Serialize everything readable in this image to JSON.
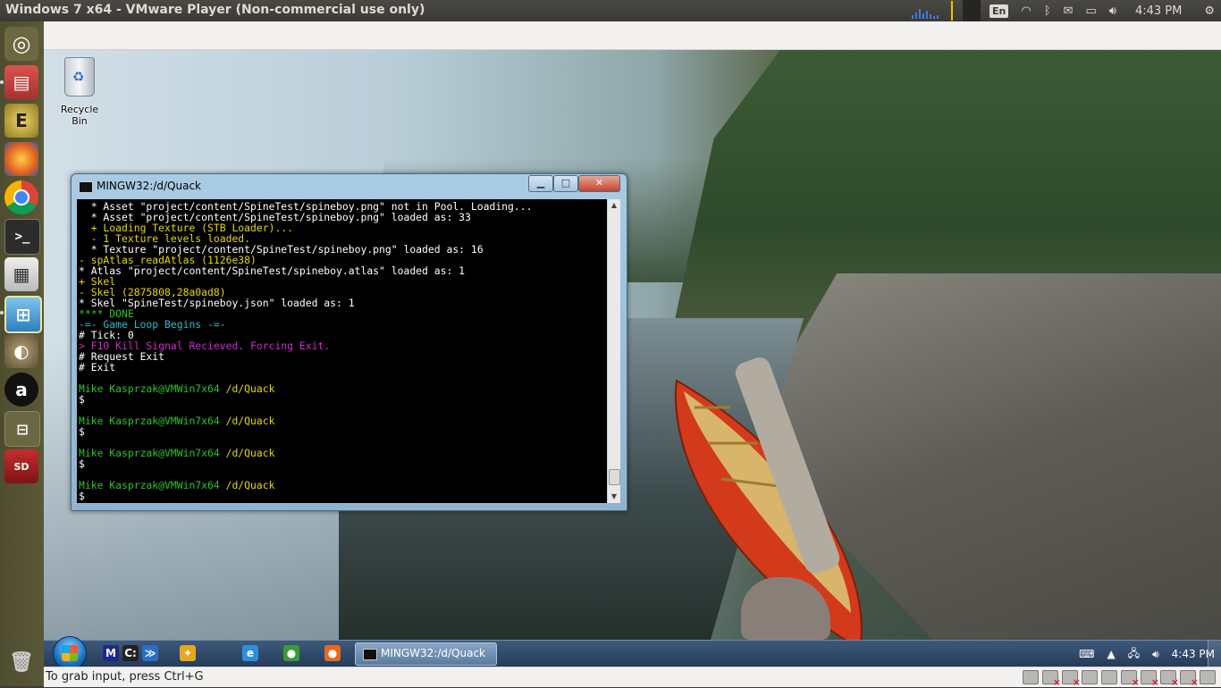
{
  "top_panel": {
    "window_title": "Windows 7 x64 - VMware Player (Non-commercial use only)",
    "keyboard_layout": "En",
    "clock": "4:43 PM"
  },
  "launcher": {
    "items": [
      {
        "name": "Dash home",
        "icon": "ubuntu-logo-icon"
      },
      {
        "name": "Files",
        "icon": "file-cabinet-icon"
      },
      {
        "name": "Mail",
        "icon": "mail-e-icon"
      },
      {
        "name": "Firefox",
        "icon": "firefox-icon"
      },
      {
        "name": "Chrome",
        "icon": "chrome-icon"
      },
      {
        "name": "Terminal",
        "icon": "terminal-icon"
      },
      {
        "name": "Calculator",
        "icon": "calculator-icon"
      },
      {
        "name": "VMware Player",
        "icon": "vmware-icon"
      },
      {
        "name": "GIMP",
        "icon": "gimp-icon"
      },
      {
        "name": "Audacity",
        "icon": "audacity-icon"
      },
      {
        "name": "Workspaces",
        "icon": "workspace-icon"
      },
      {
        "name": "SD Card",
        "icon": "sd-card-icon"
      },
      {
        "name": "Trash",
        "icon": "trash-icon"
      }
    ]
  },
  "desktop": {
    "recycle_bin_label": "Recycle Bin"
  },
  "terminal": {
    "title": "MINGW32:/d/Quack",
    "lines": [
      {
        "text": "  * Asset \"project/content/SpineTest/spineboy.png\" not in Pool. Loading...",
        "color": "#ffffff"
      },
      {
        "text": "  * Asset \"project/content/SpineTest/spineboy.png\" loaded as: 33",
        "color": "#ffffff"
      },
      {
        "text": "  + Loading Texture (STB Loader)...",
        "color": "#e6d800"
      },
      {
        "text": "  - 1 Texture levels loaded.",
        "color": "#e6d800"
      },
      {
        "text": "  * Texture \"project/content/SpineTest/spineboy.png\" loaded as: 16",
        "color": "#ffffff"
      },
      {
        "text": "- spAtlas_readAtlas (1126e38)",
        "color": "#e6d800"
      },
      {
        "text": "* Atlas \"project/content/SpineTest/spineboy.atlas\" loaded as: 1",
        "color": "#ffffff"
      },
      {
        "text": "+ Skel",
        "color": "#e6d800"
      },
      {
        "text": "- Skel (2875808,28a0ad8)",
        "color": "#e6d800"
      },
      {
        "text": "* Skel \"SpineTest/spineboy.json\" loaded as: 1",
        "color": "#ffffff"
      },
      {
        "text": "**** DONE",
        "color": "#2ec22e"
      },
      {
        "text": "-=- Game Loop Begins -=-",
        "color": "#2bbccb"
      },
      {
        "text": "# Tick: 0",
        "color": "#ffffff"
      },
      {
        "text": "> F10 Kill Signal Recieved. Forcing Exit.",
        "color": "#d22ad2"
      },
      {
        "text": "# Request Exit",
        "color": "#ffffff"
      },
      {
        "text": "# Exit",
        "color": "#ffffff"
      },
      {
        "text": "",
        "color": "#ffffff"
      },
      {
        "text": "Mike Kasprzak@VMWin7x64 /d/Quack",
        "color": "#2ec22e",
        "path": "/d/Quack",
        "path_color": "#e6d800"
      },
      {
        "text": "$",
        "color": "#ffffff"
      },
      {
        "text": "",
        "color": "#ffffff"
      },
      {
        "text": "Mike Kasprzak@VMWin7x64 /d/Quack",
        "color": "#2ec22e",
        "path": "/d/Quack",
        "path_color": "#e6d800"
      },
      {
        "text": "$",
        "color": "#ffffff"
      },
      {
        "text": "",
        "color": "#ffffff"
      },
      {
        "text": "Mike Kasprzak@VMWin7x64 /d/Quack",
        "color": "#2ec22e",
        "path": "/d/Quack",
        "path_color": "#e6d800"
      },
      {
        "text": "$",
        "color": "#ffffff"
      },
      {
        "text": "",
        "color": "#ffffff"
      },
      {
        "text": "Mike Kasprzak@VMWin7x64 /d/Quack",
        "color": "#2ec22e",
        "path": "/d/Quack",
        "path_color": "#e6d800"
      },
      {
        "text": "$",
        "color": "#ffffff"
      }
    ]
  },
  "taskbar": {
    "pinned": [
      {
        "icon": "mingw-m-icon",
        "glyph": "M",
        "color": "#1d2a8a"
      },
      {
        "icon": "cmd-icon",
        "glyph": "C:",
        "color": "#222222"
      },
      {
        "icon": "powershell-icon",
        "glyph": "≫",
        "color": "#2a6fc4"
      },
      {
        "icon": "settings-icon",
        "glyph": "✦",
        "color": "#e6a720"
      },
      {
        "icon": "internet-explorer-icon",
        "glyph": "e",
        "color": "#2b8fe0"
      },
      {
        "icon": "chrome-icon",
        "glyph": "●",
        "color": "#3a9a3a"
      },
      {
        "icon": "firefox-icon",
        "glyph": "●",
        "color": "#e66a1f"
      }
    ],
    "active_task_label": "MINGW32:/d/Quack",
    "clock": "4:43 PM"
  },
  "status_bar": {
    "hint": "To grab input, press Ctrl+G"
  }
}
